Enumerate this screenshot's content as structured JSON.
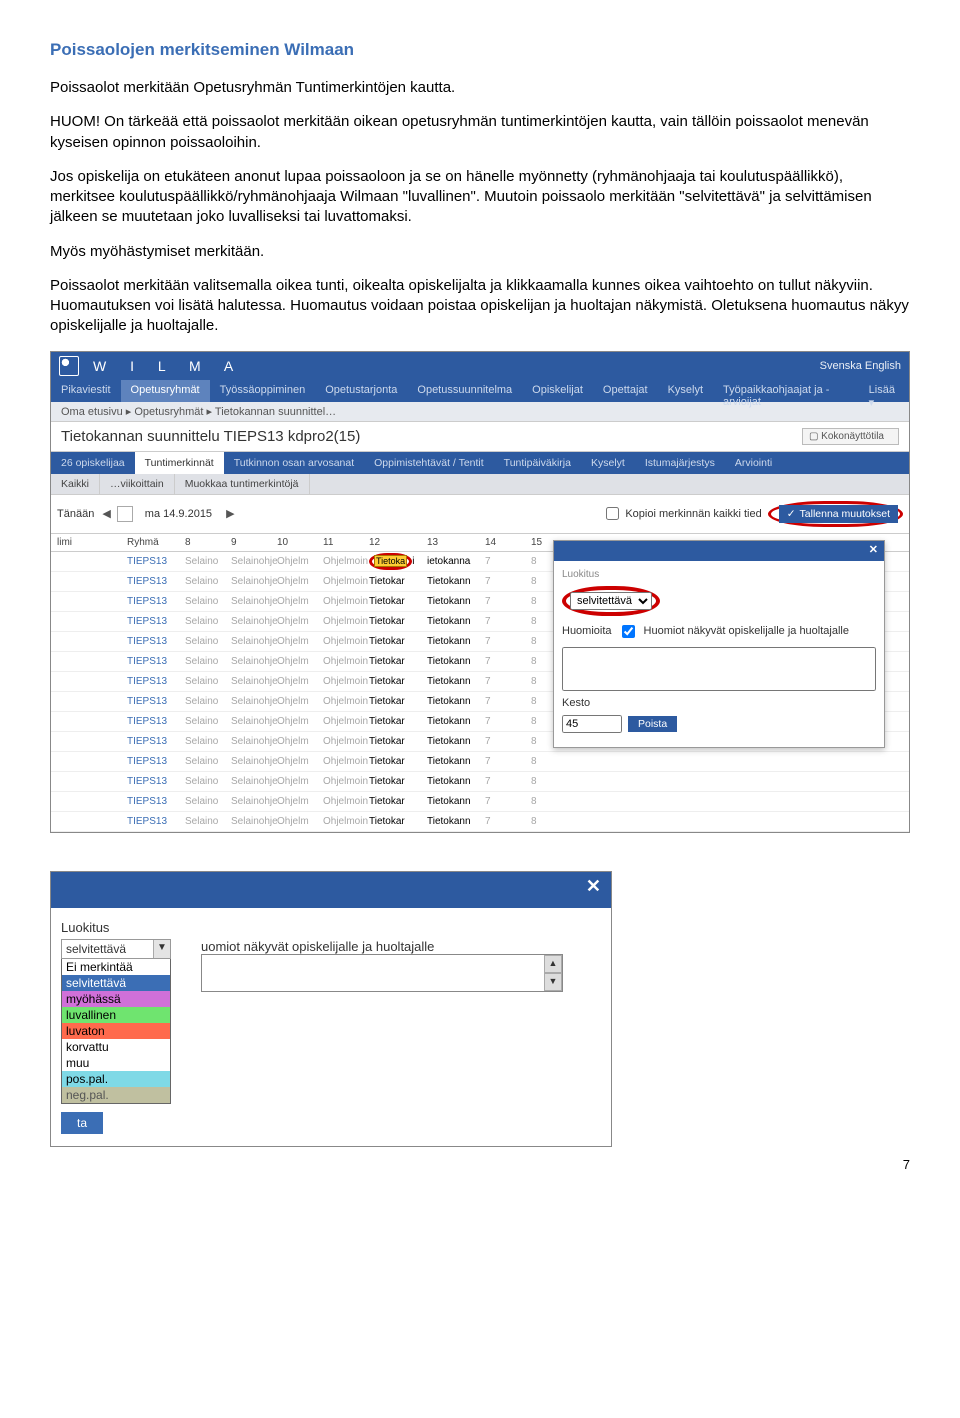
{
  "heading": "Poissaolojen merkitseminen Wilmaan",
  "para1": "Poissaolot merkitään Opetusryhmän Tuntimerkintöjen kautta.",
  "para2": "HUOM! On tärkeää että poissaolot merkitään oikean opetusryhmän tuntimerkintöjen kautta, vain tällöin poissaolot menevän kyseisen opinnon poissaoloihin.",
  "para3": "Jos opiskelija on etukäteen anonut lupaa poissaoloon ja se on hänelle myönnetty (ryhmänohjaaja tai koulutuspäällikkö), merkitsee koulutuspäällikkö/ryhmänohjaaja Wilmaan \"luvallinen\". Muutoin poissaolo merkitään \"selvitettävä\" ja selvittämisen jälkeen se muutetaan joko luvalliseksi tai luvattomaksi.",
  "para4": "Myös myöhästymiset merkitään.",
  "para5": "Poissaolot merkitään valitsemalla oikea tunti, oikealta opiskelijalta ja klikkaamalla kunnes oikea vaihtoehto on tullut näkyviin. Huomautuksen voi lisätä halutessa. Huomautus voidaan poistaa opiskelijan ja huoltajan näkymistä. Oletuksena huomautus näkyy opiskelijalle ja huoltajalle.",
  "wilma": {
    "brand": "W I L M A",
    "lang": "Svenska  English",
    "menu": [
      "Pikaviestit",
      "Opetusryhmät",
      "Työssäoppiminen",
      "Opetustarjonta",
      "Opetussuunnitelma",
      "Opiskelijat",
      "Opettajat",
      "Kyselyt",
      "Työpaikkaohjaajat ja -arvioijat"
    ],
    "menu_more": "Lisää ▾",
    "breadcrumb": "Oma etusivu ▸ Opetusryhmät ▸ Tietokannan suunnittel…",
    "page_title": "Tietokannan suunnittelu TIEPS13 kdpro2(15)",
    "fullscreen": "Kokonäyttötila",
    "tabs": [
      "26 opiskelijaa",
      "Tuntimerkinnät",
      "Tutkinnon osan arvosanat",
      "Oppimistehtävät / Tentit",
      "Tuntipäiväkirja",
      "Kyselyt",
      "Istumajärjestys",
      "Arviointi"
    ],
    "subtabs": [
      "Kaikki",
      "…viikoittain",
      "Muokkaa tuntimerkintöjä"
    ],
    "today_label": "Tänään",
    "date": "ma 14.9.2015",
    "copy_label": "Kopioi merkinnän kaikki tied",
    "save_label": "Tallenna muutokset",
    "columns": {
      "name": "limi",
      "group": "Ryhmä",
      "hours": [
        "8",
        "9",
        "10",
        "11",
        "12",
        "13",
        "14",
        "15"
      ]
    },
    "row": {
      "group": "TIEPS13",
      "c8": "Selaino",
      "c9": "Selainohje",
      "c10": "Ohjelm",
      "c11": "Ohjelmoin",
      "c12": "Tietokar",
      "c13": "Tietokann",
      "c14": "7",
      "c15": "8",
      "c12_first": "Tietoka",
      "c13_first": "ietokanna"
    },
    "row_count": 14,
    "popup": {
      "label_luokitus": "Luokitus",
      "sel_value": "selvitettävä",
      "huom_label": "Huomioita",
      "huom_check": "Huomiot näkyvät opiskelijalle ja huoltajalle",
      "kesto_label": "Kesto",
      "kesto_value": "45",
      "poista": "Poista"
    }
  },
  "shot2": {
    "luokitus_label": "Luokitus",
    "selected": "selvitettävä",
    "options": [
      {
        "label": "Ei merkintää",
        "bg": "#ffffff",
        "fg": "#000"
      },
      {
        "label": "selvitettävä",
        "bg": "#3b6eb5",
        "fg": "#fff"
      },
      {
        "label": "myöhässä",
        "bg": "#d070d9",
        "fg": "#000"
      },
      {
        "label": "luvallinen",
        "bg": "#6fe46f",
        "fg": "#000"
      },
      {
        "label": "luvaton",
        "bg": "#ff6a4d",
        "fg": "#000"
      },
      {
        "label": "korvattu",
        "bg": "#ffffff",
        "fg": "#000"
      },
      {
        "label": "muu",
        "bg": "#ffffff",
        "fg": "#000"
      },
      {
        "label": "pos.pal.",
        "bg": "#7fd9e6",
        "fg": "#000"
      },
      {
        "label": "neg.pal.",
        "bg": "#c0c0a0",
        "fg": "#555"
      }
    ],
    "right_label": "uomiot näkyvät opiskelijalle ja huoltajalle",
    "ta": "ta"
  },
  "pagenum": "7"
}
